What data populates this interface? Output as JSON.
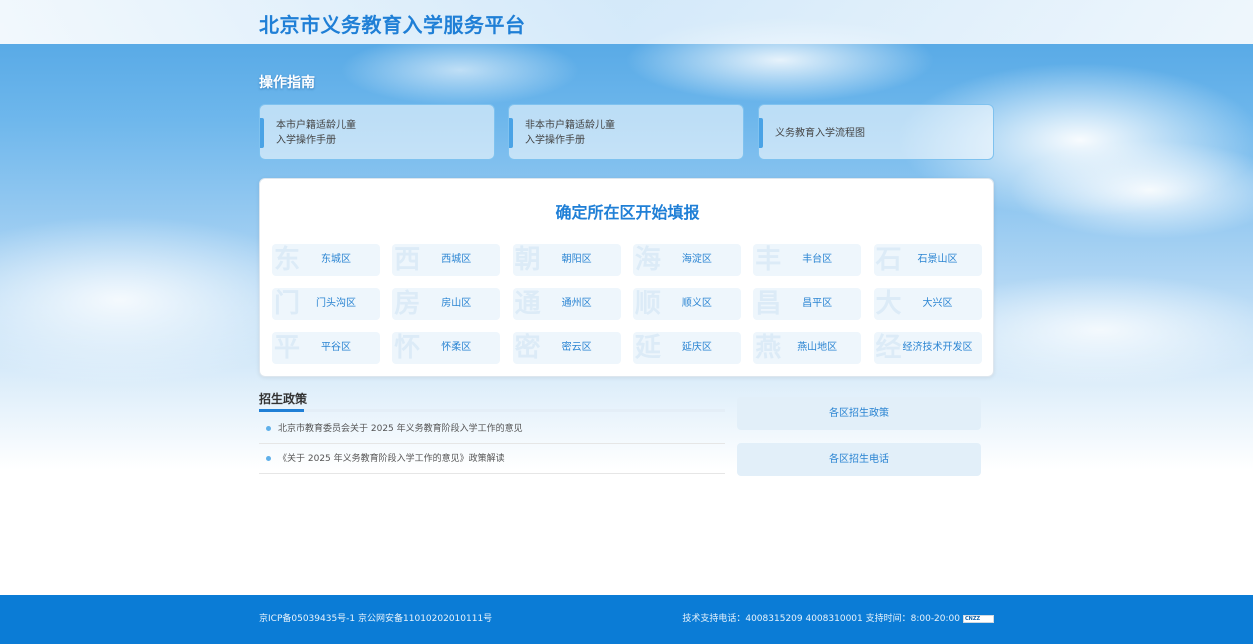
{
  "header": {
    "title": "北京市义务教育入学服务平台"
  },
  "guide": {
    "title": "操作指南",
    "cards": [
      {
        "line1": "本市户籍适龄儿童",
        "line2": "入学操作手册"
      },
      {
        "line1": "非本市户籍适龄儿童",
        "line2": "入学操作手册"
      },
      {
        "line1": "义务教育入学流程图",
        "line2": ""
      }
    ]
  },
  "districts": {
    "title": "确定所在区开始填报",
    "items": [
      {
        "label": "东城区",
        "char": "东"
      },
      {
        "label": "西城区",
        "char": "西"
      },
      {
        "label": "朝阳区",
        "char": "朝"
      },
      {
        "label": "海淀区",
        "char": "海"
      },
      {
        "label": "丰台区",
        "char": "丰"
      },
      {
        "label": "石景山区",
        "char": "石"
      },
      {
        "label": "门头沟区",
        "char": "门"
      },
      {
        "label": "房山区",
        "char": "房"
      },
      {
        "label": "通州区",
        "char": "通"
      },
      {
        "label": "顺义区",
        "char": "顺"
      },
      {
        "label": "昌平区",
        "char": "昌"
      },
      {
        "label": "大兴区",
        "char": "大"
      },
      {
        "label": "平谷区",
        "char": "平"
      },
      {
        "label": "怀柔区",
        "char": "怀"
      },
      {
        "label": "密云区",
        "char": "密"
      },
      {
        "label": "延庆区",
        "char": "延"
      },
      {
        "label": "燕山地区",
        "char": "燕"
      },
      {
        "label": "经济技术开发区",
        "char": "经"
      }
    ]
  },
  "policy": {
    "title": "招生政策",
    "items": [
      "北京市教育委员会关于 2025 年义务教育阶段入学工作的意见",
      "《关于 2025 年义务教育阶段入学工作的意见》政策解读"
    ],
    "side_buttons": [
      "各区招生政策",
      "各区招生电话"
    ]
  },
  "footer": {
    "icp": "京ICP备05039435号-1 京公网安备11010202010111号",
    "support": "技术支持电话：4008315209 4008310001 支持时间：8:00-20:00",
    "badge": "CNZZ"
  },
  "colors": {
    "brand": "#1f7fd6",
    "footer": "#0b7cd6"
  }
}
